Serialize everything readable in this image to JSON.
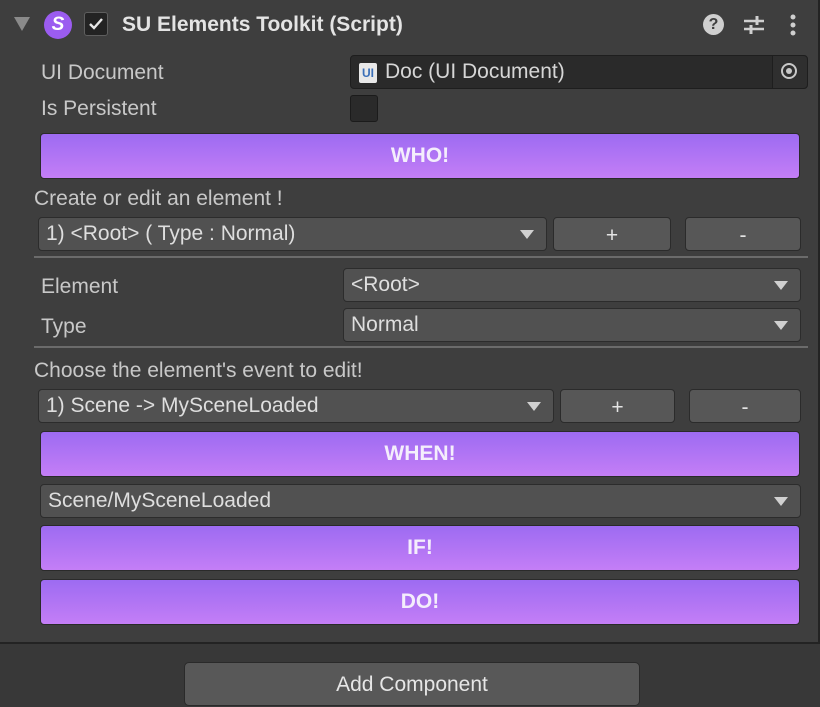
{
  "component": {
    "title": "SU Elements Toolkit (Script)",
    "logo_letter": "S",
    "accent": "#9d6bf2",
    "icons": [
      "foldout-arrow-icon",
      "script-logo-icon",
      "checkmark-icon",
      "help-icon",
      "presets-sliders-icon",
      "more-vertical-icon"
    ]
  },
  "fields": {
    "ui_document_label": "UI Document",
    "ui_document_icon_text": "UI",
    "ui_document_value": "Doc (UI Document)",
    "is_persistent_label": "Is Persistent"
  },
  "buttons": {
    "who": "WHO!",
    "when": "WHEN!",
    "if": "IF!",
    "do": "DO!",
    "add_component": "Add Component"
  },
  "element_section": {
    "heading": "Create or edit an element !",
    "selected": "1) <Root>   ( Type : Normal)",
    "add_label": "+",
    "remove_label": "-",
    "element_label": "Element",
    "element_value": "<Root>",
    "type_label": "Type",
    "type_value": "Normal"
  },
  "event_section": {
    "heading": "Choose the element's event to edit!",
    "selected": "1) Scene -> MySceneLoaded",
    "add_label": "+",
    "remove_label": "-",
    "event_path": "Scene/MySceneLoaded"
  }
}
